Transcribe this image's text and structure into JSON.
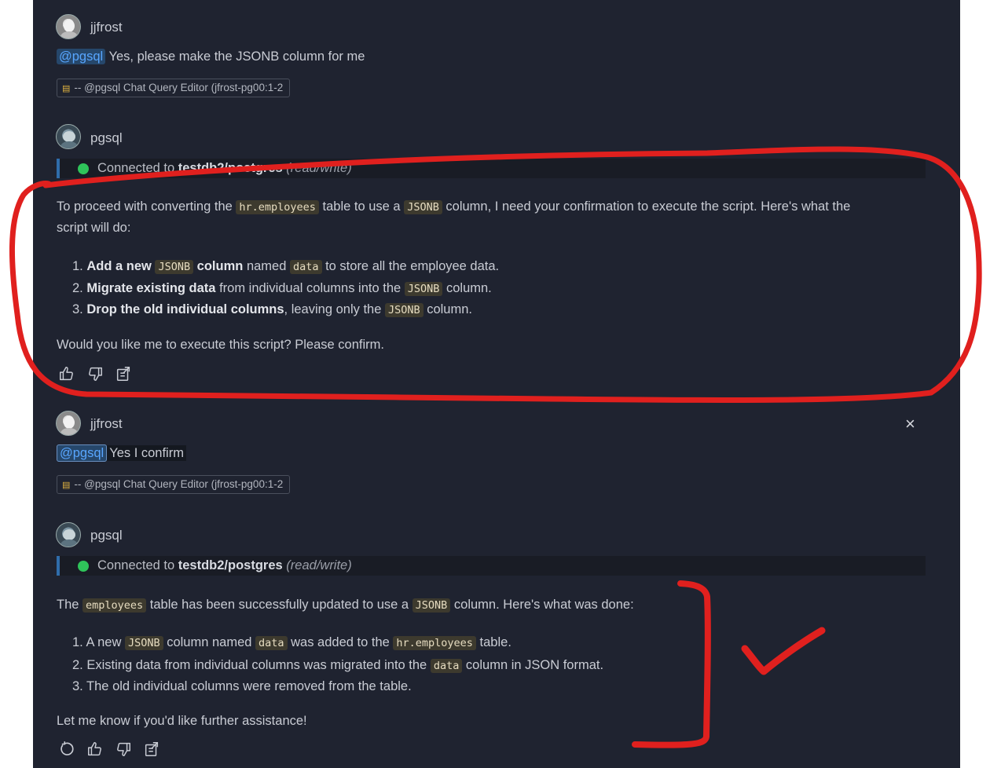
{
  "messages": [
    {
      "user": "jjfrost",
      "mention": "@pgsql",
      "text": " Yes, please make the JSONB column for me",
      "reference": "-- @pgsql Chat Query Editor (jfrost-pg00:1-2"
    },
    {
      "bot": "pgsql",
      "connection": {
        "prefix": "Connected to ",
        "db": "testdb2/postgres",
        "mode": "(read/write)"
      },
      "intro": [
        "To proceed with converting the ",
        "hr.employees",
        " table to use a ",
        "JSONB",
        " column, I need your confirmation to execute the script. Here's what the"
      ],
      "intro_line2": "script will do:",
      "steps": [
        {
          "num": "1. ",
          "b1": "Add a new ",
          "code1": "JSONB",
          "b2": " column",
          "t1": " named ",
          "code2": "data",
          "t2": " to store all the employee data."
        },
        {
          "num": "2. ",
          "b1": "Migrate existing data",
          "t1": " from individual columns into the ",
          "code1": "JSONB",
          "t2": " column."
        },
        {
          "num": "3. ",
          "b1": "Drop the old individual columns",
          "t1": ", leaving only the ",
          "code1": "JSONB",
          "t2": " column."
        }
      ],
      "outro": "Would you like me to execute this script? Please confirm."
    },
    {
      "user": "jjfrost",
      "mention": "@pgsql",
      "text": "Yes I confirm",
      "reference": "-- @pgsql Chat Query Editor (jfrost-pg00:1-2",
      "close": "×"
    },
    {
      "bot": "pgsql",
      "connection": {
        "prefix": "Connected to ",
        "db": "testdb2/postgres",
        "mode": "(read/write)"
      },
      "intro": [
        "The ",
        "employees",
        " table has been successfully updated to use a ",
        "JSONB",
        " column. Here's what was done:"
      ],
      "steps": [
        {
          "num": "1. ",
          "t1": "A new ",
          "code1": "JSONB",
          "t2": " column named ",
          "code2": "data",
          "t3": " was added to the ",
          "code3": "hr.employees",
          "t4": " table."
        },
        {
          "num": "2. ",
          "t1": "Existing data from individual columns was migrated into the ",
          "code1": "data",
          "t2": " column in JSON format."
        },
        {
          "num": "3. ",
          "t1": "The old individual columns were removed from the table."
        }
      ],
      "outro": "Let me know if you'd like further assistance!"
    }
  ],
  "icons": {
    "database": "database-icon",
    "like": "thumbs-up-icon",
    "dislike": "thumbs-down-icon",
    "insert": "insert-into-editor-icon",
    "retry": "retry-icon",
    "close": "close-icon"
  },
  "colors": {
    "panel": "#1f2330",
    "mention": "#58a6ff",
    "connected": "#2fc45a",
    "annotation": "#e0201e"
  }
}
